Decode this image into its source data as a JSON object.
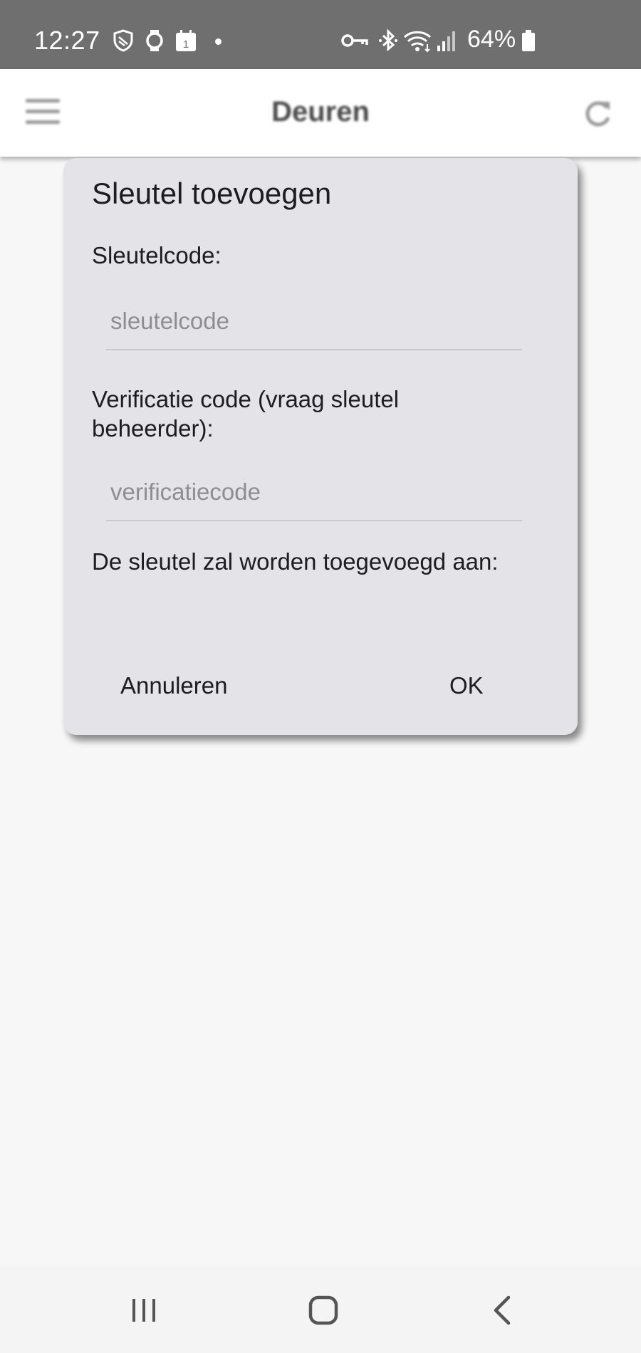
{
  "status_bar": {
    "time": "12:27",
    "battery": "64%",
    "icons": [
      "shield-icon",
      "watch-icon",
      "calendar-icon",
      "notification-dot",
      "vpn-key-icon",
      "bluetooth-icon",
      "wifi-icon",
      "signal-icon",
      "battery-icon"
    ],
    "calendar_day": "1"
  },
  "app_bar": {
    "title": "Deuren",
    "left_icon": "menu-icon",
    "right_icon": "refresh-icon"
  },
  "dialog": {
    "title": "Sleutel toevoegen",
    "key_label": "Sleutelcode:",
    "key_placeholder": "sleutelcode",
    "key_value": "",
    "verify_label": "Verificatie code (vraag sleutel beheerder):",
    "verify_placeholder": "verificatiecode",
    "verify_value": "",
    "added_label": "De sleutel zal worden toegevoegd aan:",
    "cancel_label": "Annuleren",
    "ok_label": "OK"
  },
  "nav_bar": {
    "icons": [
      "recents-icon",
      "home-icon",
      "back-icon"
    ]
  },
  "colors": {
    "status_bar_bg": "#6f6f6f",
    "dialog_bg": "#e4e3e8",
    "page_bg": "#f7f7f7",
    "text": "#1d1d1f",
    "placeholder": "#8e8e92"
  }
}
